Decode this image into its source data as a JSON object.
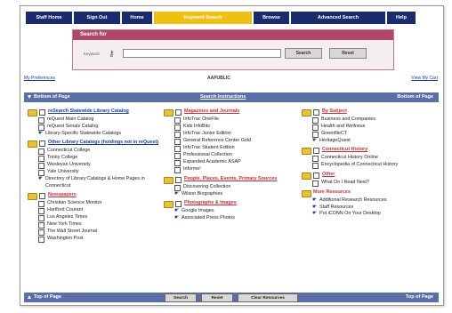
{
  "nav": {
    "tabs": [
      {
        "label": "Staff Home",
        "width": 52,
        "active": false
      },
      {
        "label": "Sign Out",
        "width": 52,
        "active": false
      },
      {
        "label": "Home",
        "width": 34,
        "active": false
      },
      {
        "label": "Keyword Search",
        "width": 110,
        "active": true
      },
      {
        "label": "Browse",
        "width": 40,
        "active": false
      },
      {
        "label": "Advanced Search",
        "width": 106,
        "active": false
      },
      {
        "label": "Help",
        "width": 32,
        "active": false
      }
    ]
  },
  "search": {
    "title": "Search for",
    "keyword_label": "Keyword",
    "input_value": "",
    "search_button": "Search",
    "reset_button": "Reset"
  },
  "links": {
    "preferences": "My Preferences",
    "center_label": "AAPUBLIC",
    "view_cart": "View My Cart"
  },
  "bars": {
    "top_left": "Bottom of Page",
    "top_center": "Search Instructions",
    "top_right": "Bottom of Page",
    "bottom_left": "Top of Page",
    "bottom_right": "Top of Page"
  },
  "buttons": {
    "search": "Search",
    "reset": "Reset",
    "clear": "Clear Resources"
  },
  "col1": {
    "s1": "reSearch Statewide Library Catalog",
    "s1a": "reQuest Main Catalog",
    "s1b": "reQuest Serials Catalog",
    "s1c": "Library-Specific Statewide Catalogs",
    "s2": "Other Library Catalogs (holdings not in reQuest)",
    "s2a": "Connecticut College",
    "s2b": "Trinity College",
    "s2c": "Wesleyan University",
    "s2d": "Yale University",
    "s2e": "Directory of Library Catalogs & Home Pages in Connecticut",
    "s3": "Newspapers",
    "s3a": "Christian Science Monitor",
    "s3b": "Hartford Courant",
    "s3c": "Los Angeles Times",
    "s3d": "New York Times",
    "s3e": "The Wall Street Journal",
    "s3f": "Washington Post"
  },
  "col2": {
    "s1": "Magazines and Journals",
    "s1a": "InfoTrac OneFile",
    "s1b": "Kids InfoBits",
    "s1c": "InfoTrac Junior Edition",
    "s1d": "General Reference Center Gold",
    "s1e": "InfoTrac Student Edition",
    "s1f": "Professional Collection",
    "s1g": "Expanded Academic ASAP",
    "s1h": "Informe!",
    "s2": "People, Places, Events, Primary Sources",
    "s2a": "Discovering Collection",
    "s2b": "Wilson Biographies",
    "s3": "Photographs & Images",
    "s3a": "Google Images",
    "s3b": "Associated Press Photos"
  },
  "col3": {
    "s1": "By Subject",
    "s1a": "Business and Companies",
    "s1b": "Health and Wellness",
    "s1c": "GreenfileCT",
    "s1d": "HeritageQuest",
    "s2": "Connecticut History",
    "s2a": "Connecticut History Online",
    "s2b": "Encyclopedia of Connecticut History",
    "s3": "Other",
    "s3a": "What Do I Read Next?",
    "s4": "More Resources",
    "s4a": "Additional Research Resources",
    "s4b": "Staff Resources",
    "s4c": "Put iCONN On Your Desktop"
  },
  "colors": {
    "nav": "#1b2c6e",
    "nav_active": "#f0c010",
    "bar": "#5a6fa6",
    "search_bar": "#b0476a",
    "link": "#1a3d9a",
    "heading_red": "#c0303a"
  }
}
